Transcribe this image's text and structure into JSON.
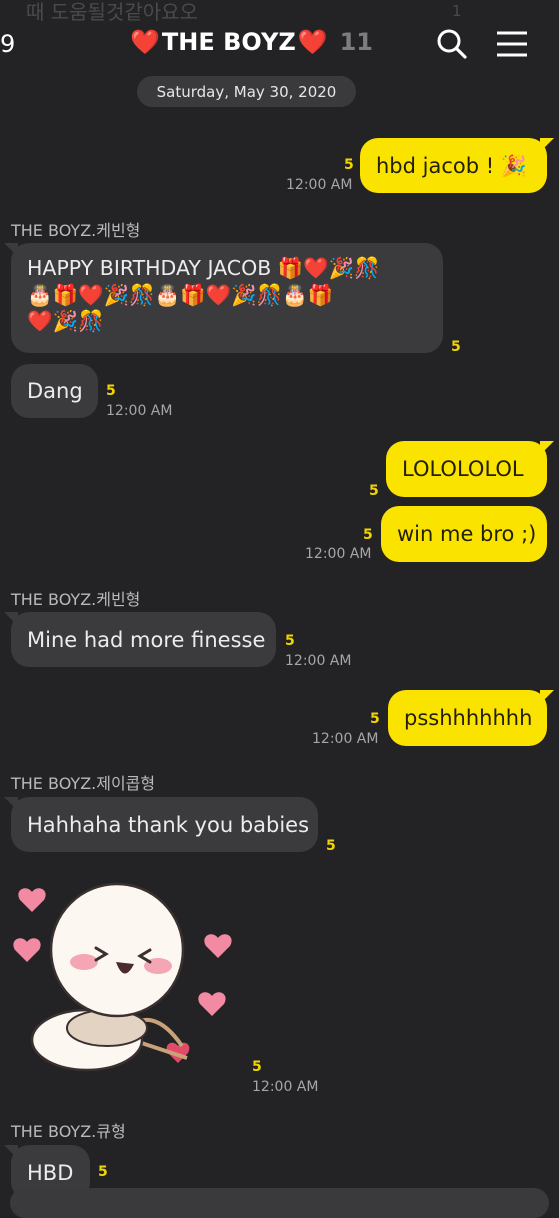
{
  "ghost_preview": {
    "text": "때 도움될것같아요오",
    "count": "1"
  },
  "header": {
    "back_count": "9",
    "title": "THE BOYZ",
    "member_count": "11",
    "heart_glyph": "❤️",
    "search_icon": "search-icon",
    "menu_icon": "hamburger-menu-icon"
  },
  "date_divider": "Saturday, May 30, 2020",
  "messages": [
    {
      "dir": "out",
      "text": "hbd jacob ! 🎉",
      "unread": "5",
      "time": "12:00 AM"
    },
    {
      "dir": "in",
      "sender": "THE BOYZ.케빈형",
      "line1": "HAPPY BIRTHDAY JACOB 🎁❤️🎉🎊",
      "line2": "🎂🎁❤️🎉🎊🎂🎁❤️🎉🎊🎂🎁",
      "line3": "❤️🎉🎊",
      "unread": "5"
    },
    {
      "dir": "in",
      "text": "Dang",
      "unread": "5",
      "time": "12:00 AM"
    },
    {
      "dir": "out",
      "text": "LOLOLOLOL",
      "unread": "5"
    },
    {
      "dir": "out",
      "text": "win me bro ;)",
      "unread": "5",
      "time": "12:00 AM"
    },
    {
      "dir": "in",
      "sender": "THE BOYZ.케빈형",
      "text": "Mine had more finesse",
      "unread": "5",
      "time": "12:00 AM"
    },
    {
      "dir": "out",
      "text": "psshhhhhhh",
      "unread": "5",
      "time": "12:00 AM"
    },
    {
      "dir": "in",
      "sender": "THE BOYZ.제이콥형",
      "text": "Hahhaha thank you babies",
      "unread": "5"
    },
    {
      "dir": "in",
      "type": "emoticon",
      "sticker": "cupid-baby-sticker",
      "unread": "5",
      "time": "12:00 AM"
    },
    {
      "dir": "in",
      "sender": "THE BOYZ.큐형",
      "text": "HBD",
      "unread": "5"
    }
  ],
  "colors": {
    "background": "#232325",
    "outgoing_bubble": "#fbe300",
    "incoming_bubble": "#3b3b3e",
    "unread_count": "#f2d500",
    "heart": "#ef2a3a"
  }
}
